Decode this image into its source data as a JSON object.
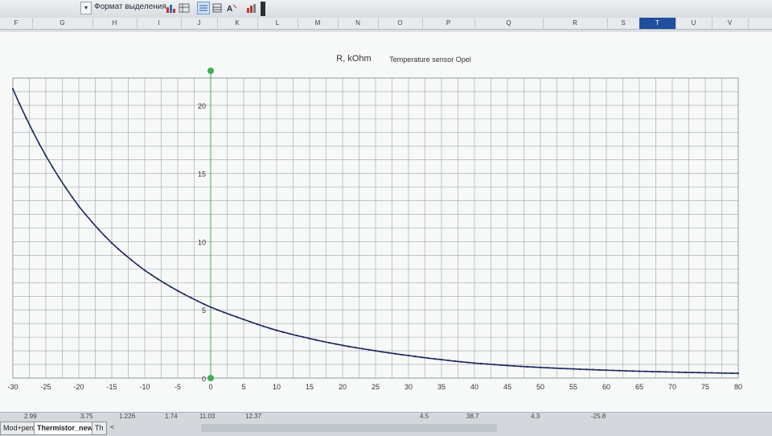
{
  "toolbar": {
    "format_selection_label": "Формат выделения"
  },
  "columns": [
    {
      "label": "F",
      "sel": false
    },
    {
      "label": "G",
      "sel": false
    },
    {
      "label": "H",
      "sel": false
    },
    {
      "label": "I",
      "sel": false
    },
    {
      "label": "J",
      "sel": false
    },
    {
      "label": "K",
      "sel": false
    },
    {
      "label": "L",
      "sel": false
    },
    {
      "label": "M",
      "sel": false
    },
    {
      "label": "N",
      "sel": false
    },
    {
      "label": "O",
      "sel": false
    },
    {
      "label": "P",
      "sel": false
    },
    {
      "label": "Q",
      "sel": false
    },
    {
      "label": "R",
      "sel": false
    },
    {
      "label": "S",
      "sel": false
    },
    {
      "label": "T",
      "sel": true
    },
    {
      "label": "U",
      "sel": false
    },
    {
      "label": "V",
      "sel": false
    }
  ],
  "status_values": [
    "2.99",
    "3.75",
    "1.226",
    "1.74",
    "11.03",
    "12.37",
    "4.5",
    "38.7",
    "4.3",
    "-25.8"
  ],
  "sheet_tabs": [
    "Mod+perc",
    "Thermistor_new",
    "Th"
  ],
  "colors": {
    "curve": "#1a2a5c",
    "grid": "#9ea3a8",
    "marker": "#3fae4f",
    "selected_col": "#1f4f9e"
  },
  "chart_data": {
    "type": "line",
    "ylabel": "R, kOhm",
    "title": "Temperature sensor Opel",
    "xlim": [
      -30,
      80
    ],
    "ylim": [
      0,
      22
    ],
    "x_ticks": [
      -30,
      -25,
      -20,
      -15,
      -10,
      -5,
      0,
      5,
      10,
      15,
      20,
      25,
      30,
      35,
      40,
      45,
      50,
      55,
      60,
      65,
      70,
      75,
      80
    ],
    "y_ticks": [
      0,
      5,
      10,
      15,
      20
    ],
    "grid": true,
    "series": [
      {
        "x": [
          -30,
          -25,
          -20,
          -15,
          -10,
          -5,
          0,
          5,
          10,
          15,
          20,
          25,
          30,
          35,
          40,
          45,
          50,
          55,
          60,
          65,
          70,
          75,
          80
        ],
        "values": [
          21.2,
          16.3,
          12.6,
          9.9,
          7.9,
          6.4,
          5.2,
          4.3,
          3.5,
          2.9,
          2.4,
          2.0,
          1.65,
          1.35,
          1.1,
          0.92,
          0.78,
          0.67,
          0.58,
          0.5,
          0.44,
          0.39,
          0.35
        ]
      }
    ]
  }
}
